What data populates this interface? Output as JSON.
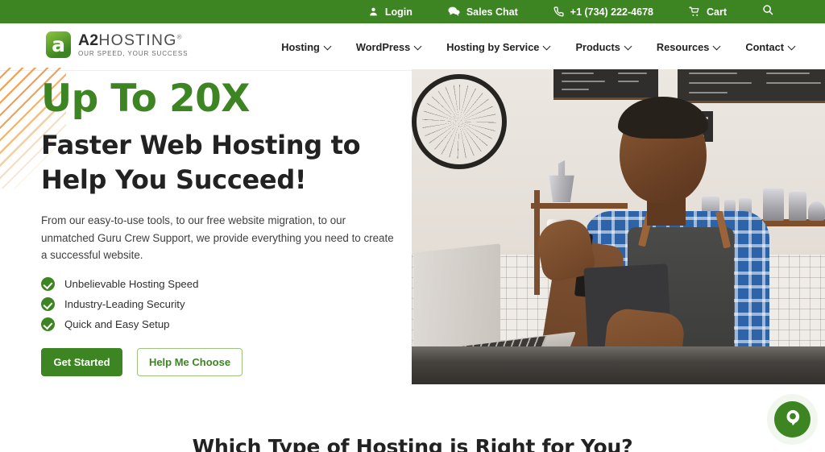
{
  "topbar": {
    "items": [
      {
        "label": "Login",
        "icon": "user-icon"
      },
      {
        "label": "Sales Chat",
        "icon": "chat-bubbles-icon"
      },
      {
        "label": "+1 (734) 222-4678",
        "icon": "phone-icon"
      },
      {
        "label": "Cart",
        "icon": "shopping-cart-icon"
      }
    ],
    "search_icon": "search-icon"
  },
  "logo": {
    "mark": "a2-logo-mark",
    "name_bold": "A2",
    "name_light": "HOSTING",
    "registered": "®",
    "tagline": "OUR SPEED, YOUR SUCCESS"
  },
  "nav": {
    "items": [
      {
        "label": "Hosting"
      },
      {
        "label": "WordPress"
      },
      {
        "label": "Hosting by Service"
      },
      {
        "label": "Products"
      },
      {
        "label": "Resources"
      },
      {
        "label": "Contact"
      }
    ]
  },
  "hero": {
    "eyebrow": "Up To 20X",
    "title_line1": "Faster Web Hosting to",
    "title_line2": "Help You Succeed!",
    "description": "From our easy-to-use tools, to our free website migration, to our unmatched Guru Crew Support, we provide everything you need to create a successful website.",
    "features": [
      "Unbelievable Hosting Speed",
      "Industry-Leading Security",
      "Quick and Easy Setup"
    ],
    "primary_button": "Get Started",
    "secondary_button": "Help Me Choose",
    "image_alt": "Smiling barista talking on phone holding tablet in a cafe"
  },
  "next_section": {
    "heading": "Which Type of Hosting is Right for You?"
  },
  "chat_widget": {
    "icon": "chat-bubble-icon"
  },
  "colors": {
    "brand_green": "#3d8522",
    "accent_orange": "#f0a050",
    "text_dark": "#222222",
    "topbar_green": "#3d8522"
  }
}
